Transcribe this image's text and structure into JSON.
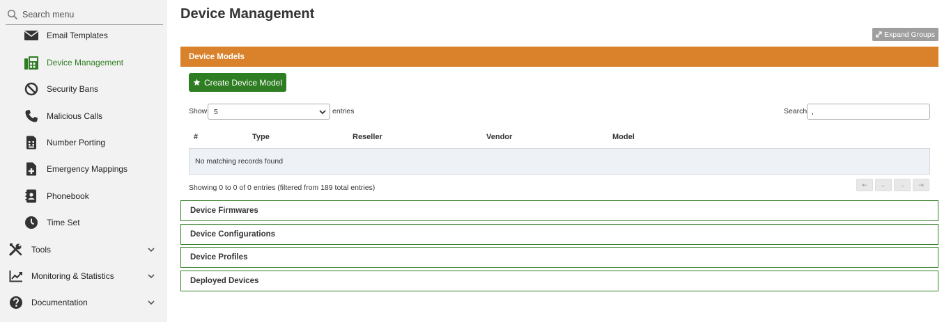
{
  "sidebar": {
    "search_placeholder": "Search menu",
    "sub_items": [
      {
        "label": "Email Templates",
        "icon": "envelope-icon"
      },
      {
        "label": "Device Management",
        "icon": "fax-icon",
        "active": true
      },
      {
        "label": "Security Bans",
        "icon": "ban-icon"
      },
      {
        "label": "Malicious Calls",
        "icon": "phone-icon"
      },
      {
        "label": "Number Porting",
        "icon": "sim-card-icon"
      },
      {
        "label": "Emergency Mappings",
        "icon": "file-medical-icon"
      },
      {
        "label": "Phonebook",
        "icon": "address-book-icon"
      },
      {
        "label": "Time Set",
        "icon": "clock-icon"
      }
    ],
    "groups": [
      {
        "label": "Tools",
        "icon": "tools-icon"
      },
      {
        "label": "Monitoring & Statistics",
        "icon": "chart-line-icon"
      },
      {
        "label": "Documentation",
        "icon": "question-circle-icon"
      }
    ]
  },
  "main": {
    "title": "Device Management",
    "expand_label": "Expand Groups",
    "models_panel": {
      "title": "Device Models",
      "create_label": "Create Device Model",
      "show_label": "Show",
      "entries_value": "5",
      "entries_label": "entries",
      "search_label": "Search:",
      "search_value": ",",
      "columns": [
        "#",
        "Type",
        "Reseller",
        "Vendor",
        "Model"
      ],
      "empty_message": "No matching records found",
      "info": "Showing 0 to 0 of 0 entries (filtered from 189 total entries)",
      "pagination": [
        "⇤",
        "←",
        "→",
        "⇥"
      ]
    },
    "collapsed_panels": [
      "Device Firmwares",
      "Device Configurations",
      "Device Profiles",
      "Deployed Devices"
    ]
  },
  "colors": {
    "accent_green": "#2e7d22",
    "header_orange": "#d9822b",
    "sidebar_bg": "#f2f2f2"
  }
}
